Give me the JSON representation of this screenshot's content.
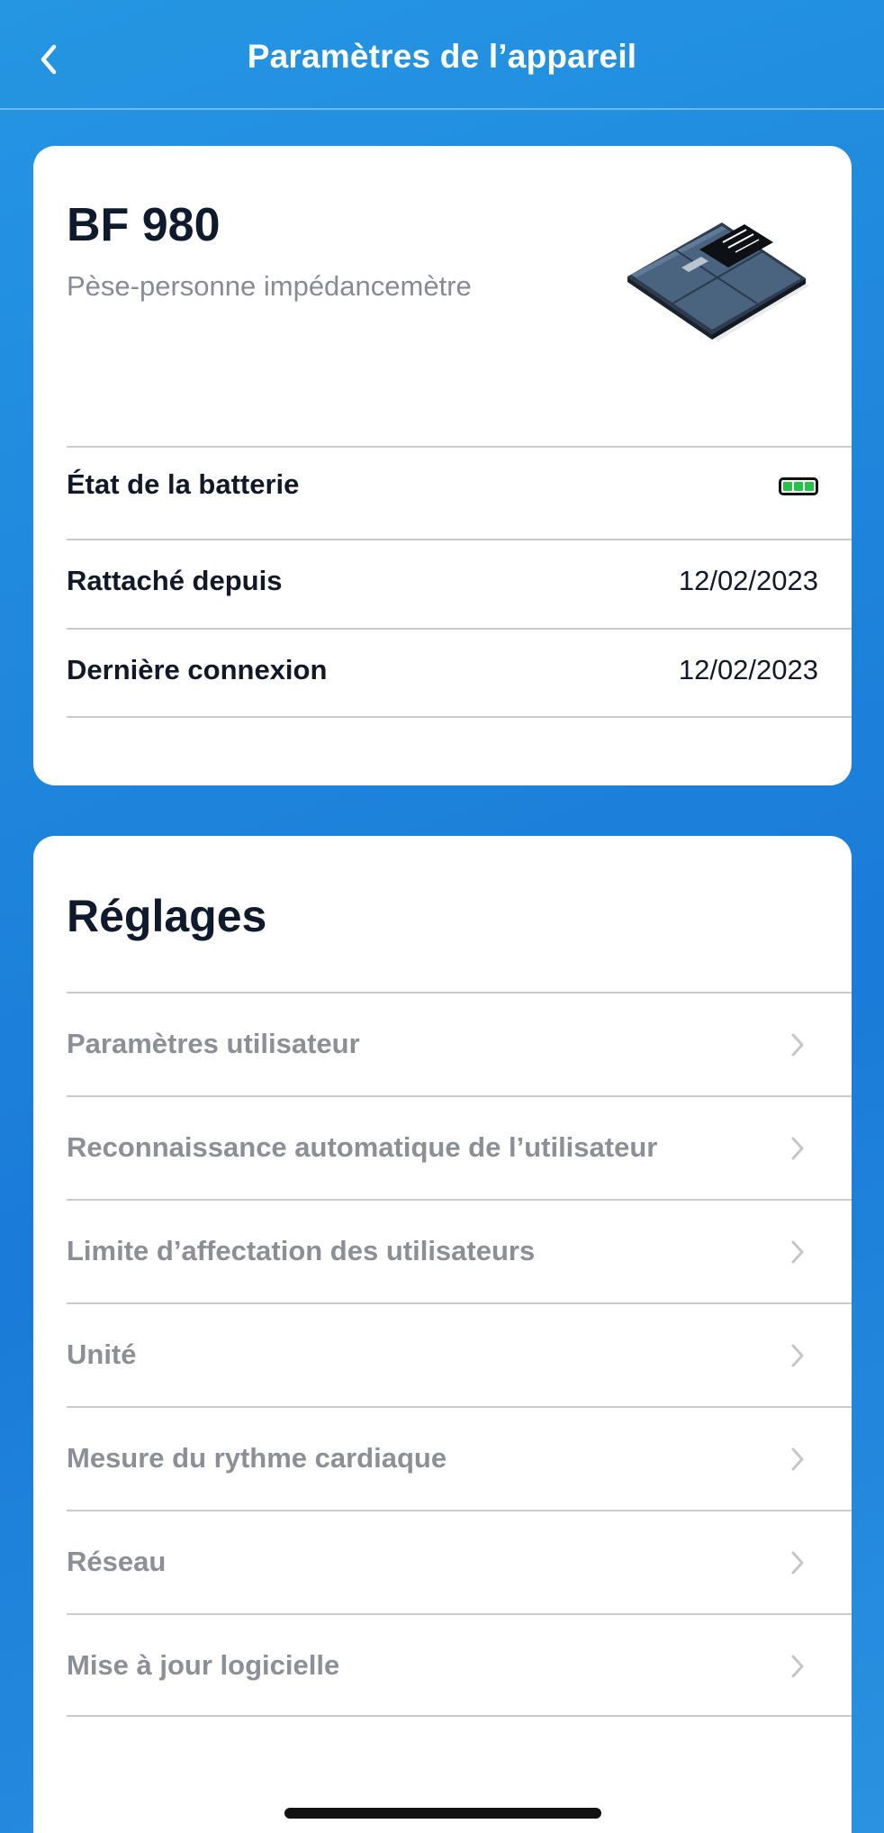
{
  "header": {
    "title": "Paramètres de l’appareil",
    "back_icon": "chevron-left-icon"
  },
  "device": {
    "name": "BF 980",
    "type": "Pèse-personne impédancemètre",
    "image": "body-fat-scale-image",
    "info": [
      {
        "label": "État de la batterie",
        "value": null,
        "battery_level": 1.0,
        "battery_color": "#26c24a"
      },
      {
        "label": "Rattaché depuis",
        "value": "12/02/2023"
      },
      {
        "label": "Dernière connexion",
        "value": "12/02/2023"
      }
    ]
  },
  "settings": {
    "title": "Réglages",
    "items": [
      {
        "label": "Paramètres utilisateur"
      },
      {
        "label": "Reconnaissance automatique de l’utilisateur"
      },
      {
        "label": "Limite d’affectation des utilisateurs"
      },
      {
        "label": "Unité"
      },
      {
        "label": "Mesure du rythme cardiaque"
      },
      {
        "label": "Réseau"
      },
      {
        "label": "Mise à jour logicielle"
      }
    ]
  },
  "colors": {
    "background": "#1f86dc",
    "muted_text": "#8b8f96",
    "battery_green": "#26c24a"
  }
}
